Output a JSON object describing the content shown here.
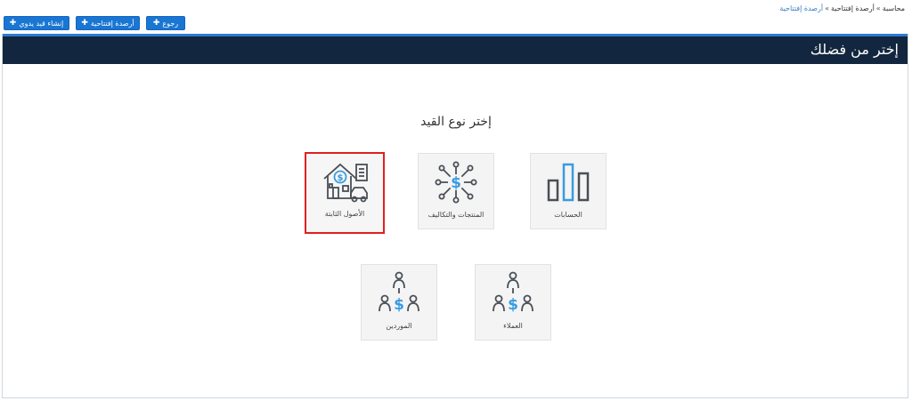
{
  "breadcrumb": {
    "items": [
      "محاسبة",
      "أرصدة إفتتاحية",
      "أرصدة إفتتاحية"
    ],
    "separator": "»"
  },
  "toolbar": {
    "back_label": "رجوع",
    "opening_balances_label": "أرصدة إفتتاحية",
    "manual_entry_label": "إنشاء قيد يدوي"
  },
  "panel": {
    "title": "إختر من فضلك"
  },
  "main": {
    "section_title": "إختر نوع القيد",
    "options": [
      {
        "label": "الحسابات",
        "icon": "bar-chart-icon",
        "selected": false
      },
      {
        "label": "المنتجات والتكاليف",
        "icon": "cost-network-icon",
        "selected": false
      },
      {
        "label": "الأصول الثابتة",
        "icon": "house-asset-icon",
        "selected": true
      },
      {
        "label": "العملاء",
        "icon": "hierarchy-money-icon",
        "selected": false
      },
      {
        "label": "الموردين",
        "icon": "hierarchy-money-icon",
        "selected": false
      }
    ]
  },
  "colors": {
    "header_bg": "#13263f",
    "header_accent": "#2c7bd3",
    "button_bg": "#1976d2",
    "selected_border": "#e02020",
    "icon_dark": "#4a4f57",
    "icon_blue": "#3a9be0"
  }
}
